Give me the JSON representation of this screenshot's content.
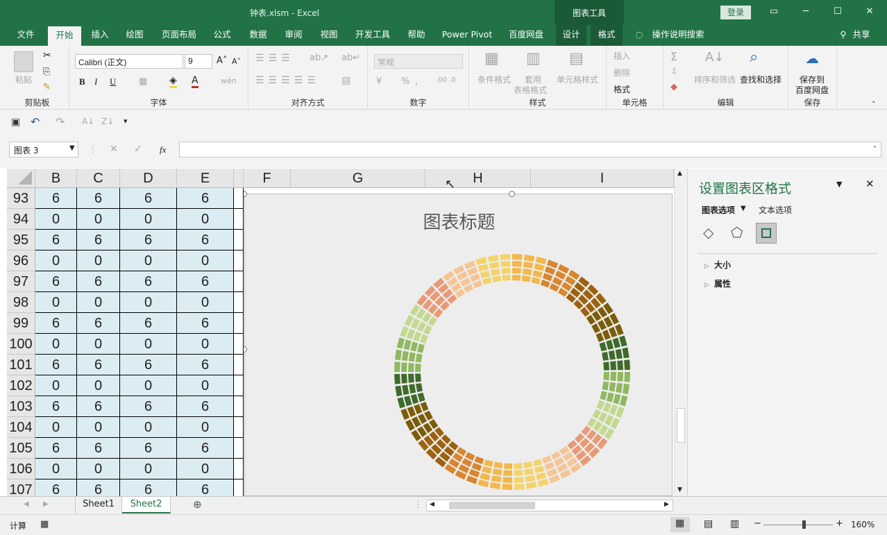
{
  "window": {
    "title": "钟表.xlsm  -  Excel",
    "context_tools": "图表工具",
    "login": "登录"
  },
  "tabs": [
    "文件",
    "开始",
    "插入",
    "绘图",
    "页面布局",
    "公式",
    "数据",
    "审阅",
    "视图",
    "开发工具",
    "帮助",
    "Power Pivot",
    "百度网盘",
    "设计",
    "格式"
  ],
  "tell_me": "操作说明搜索",
  "share": "共享",
  "ribbon": {
    "clipboard": {
      "label": "剪贴板",
      "paste": "粘贴"
    },
    "font": {
      "label": "字体",
      "name": "Calibri (正文)",
      "size": "9",
      "bold": "B",
      "italic": "I",
      "underline": "U"
    },
    "alignment": {
      "label": "对齐方式"
    },
    "number": {
      "label": "数字",
      "format": "常规",
      "percent": "%"
    },
    "styles": {
      "label": "样式",
      "cond": "条件格式",
      "table_a": "套用",
      "table_b": "表格格式",
      "cell_style": "单元格样式"
    },
    "cells": {
      "label": "单元格",
      "insert": "插入",
      "delete": "删除",
      "format": "格式"
    },
    "editing": {
      "label": "编辑",
      "sort": "排序和筛选",
      "find": "查找和选择"
    },
    "save": {
      "label": "保存",
      "btn_a": "保存到",
      "btn_b": "百度网盘"
    }
  },
  "namebox": "图表 3",
  "fx": "fx",
  "columns": [
    "B",
    "C",
    "D",
    "E",
    "F",
    "G",
    "H",
    "I"
  ],
  "rows": [
    {
      "num": "93",
      "vals": [
        "6",
        "6",
        "6",
        "6"
      ]
    },
    {
      "num": "94",
      "vals": [
        "0",
        "0",
        "0",
        "0"
      ]
    },
    {
      "num": "95",
      "vals": [
        "6",
        "6",
        "6",
        "6"
      ]
    },
    {
      "num": "96",
      "vals": [
        "0",
        "0",
        "0",
        "0"
      ]
    },
    {
      "num": "97",
      "vals": [
        "6",
        "6",
        "6",
        "6"
      ]
    },
    {
      "num": "98",
      "vals": [
        "0",
        "0",
        "0",
        "0"
      ]
    },
    {
      "num": "99",
      "vals": [
        "6",
        "6",
        "6",
        "6"
      ]
    },
    {
      "num": "100",
      "vals": [
        "0",
        "0",
        "0",
        "0"
      ]
    },
    {
      "num": "101",
      "vals": [
        "6",
        "6",
        "6",
        "6"
      ]
    },
    {
      "num": "102",
      "vals": [
        "0",
        "0",
        "0",
        "0"
      ]
    },
    {
      "num": "103",
      "vals": [
        "6",
        "6",
        "6",
        "6"
      ]
    },
    {
      "num": "104",
      "vals": [
        "0",
        "0",
        "0",
        "0"
      ]
    },
    {
      "num": "105",
      "vals": [
        "6",
        "6",
        "6",
        "6"
      ]
    },
    {
      "num": "106",
      "vals": [
        "0",
        "0",
        "0",
        "0"
      ]
    },
    {
      "num": "107",
      "vals": [
        "6",
        "6",
        "6",
        "6"
      ]
    }
  ],
  "chart_title": "图表标题",
  "colors": {
    "accent": "#217346",
    "ring": [
      "#f2b84b",
      "#d8862f",
      "#9c6210",
      "#7a5d0a",
      "#3f6b2a",
      "#8fb860",
      "#c3d98f",
      "#e79a76",
      "#f5c596",
      "#f4d36a"
    ]
  },
  "pane": {
    "title": "设置图表区格式",
    "tab_chart": "图表选项",
    "tab_text": "文本选项",
    "sections": [
      "大小",
      "属性"
    ]
  },
  "sheets": [
    "Sheet1",
    "Sheet2"
  ],
  "status": {
    "mode": "计算",
    "zoom": "160%"
  }
}
